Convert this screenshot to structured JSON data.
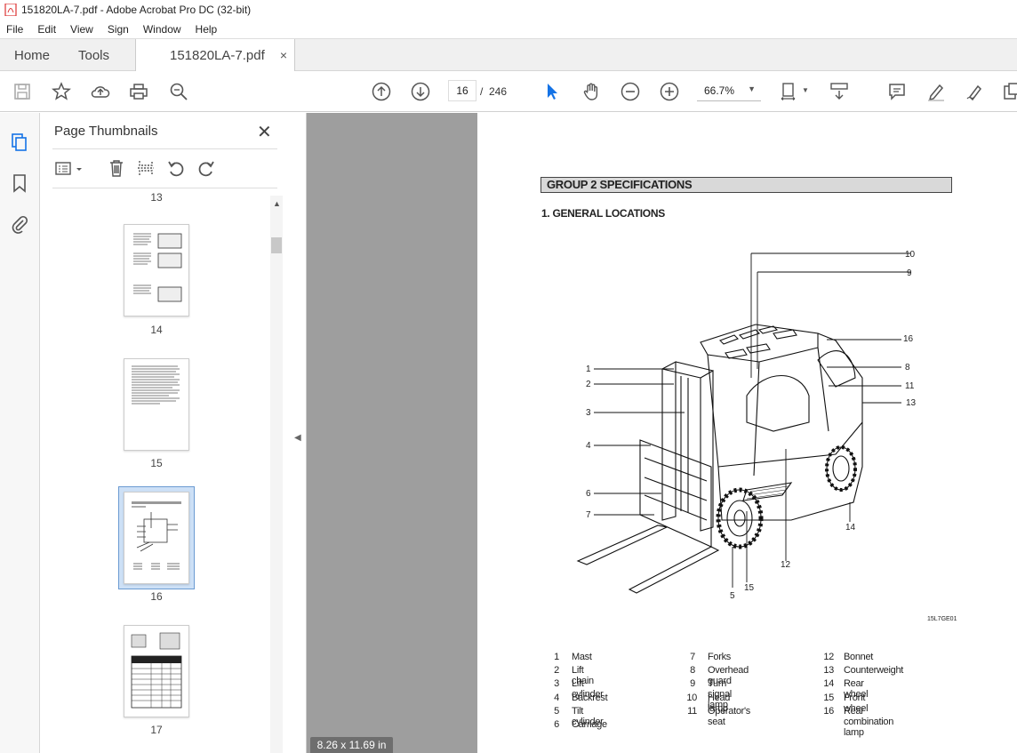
{
  "window": {
    "title": "151820LA-7.pdf - Adobe Acrobat Pro DC (32-bit)"
  },
  "menu": [
    "File",
    "Edit",
    "View",
    "Sign",
    "Window",
    "Help"
  ],
  "tabs": {
    "home": "Home",
    "tools": "Tools",
    "file": "151820LA-7.pdf",
    "close": "×"
  },
  "toolbar": {
    "current_page": "16",
    "page_sep": "/",
    "total_pages": "246",
    "zoom": "66.7%"
  },
  "panel": {
    "title": "Page Thumbnails",
    "thumbnails": [
      {
        "label": "13"
      },
      {
        "label": "14"
      },
      {
        "label": "15"
      },
      {
        "label": "16",
        "selected": true
      },
      {
        "label": "17"
      }
    ]
  },
  "status": {
    "page_size": "8.26 x 11.69 in"
  },
  "document": {
    "group_title": "GROUP 2  SPECIFICATIONS",
    "section_title": "1. GENERAL LOCATIONS",
    "figure_code": "15L7GE01",
    "callouts": [
      "1",
      "2",
      "3",
      "4",
      "5",
      "6",
      "7",
      "8",
      "9",
      "10",
      "11",
      "12",
      "13",
      "14",
      "15",
      "16"
    ],
    "legend": [
      {
        "num": "1",
        "name": "Mast"
      },
      {
        "num": "2",
        "name": "Lift chain"
      },
      {
        "num": "3",
        "name": "Lift cylinder"
      },
      {
        "num": "4",
        "name": "Backrest"
      },
      {
        "num": "5",
        "name": "Tilt cylinder"
      },
      {
        "num": "6",
        "name": "Carriage"
      },
      {
        "num": "7",
        "name": "Forks"
      },
      {
        "num": "8",
        "name": "Overhead guard"
      },
      {
        "num": "9",
        "name": "Turn signal lamp"
      },
      {
        "num": "10",
        "name": "Head lamp"
      },
      {
        "num": "11",
        "name": "Operator's seat"
      },
      {
        "num": "12",
        "name": "Bonnet"
      },
      {
        "num": "13",
        "name": "Counterweight"
      },
      {
        "num": "14",
        "name": "Rear wheel"
      },
      {
        "num": "15",
        "name": "Front wheel"
      },
      {
        "num": "16",
        "name": "Rear combination lamp"
      }
    ]
  },
  "colors": {
    "accent": "#1473e6",
    "doc_bg": "#9e9e9e",
    "selection": "#cde0f6"
  }
}
